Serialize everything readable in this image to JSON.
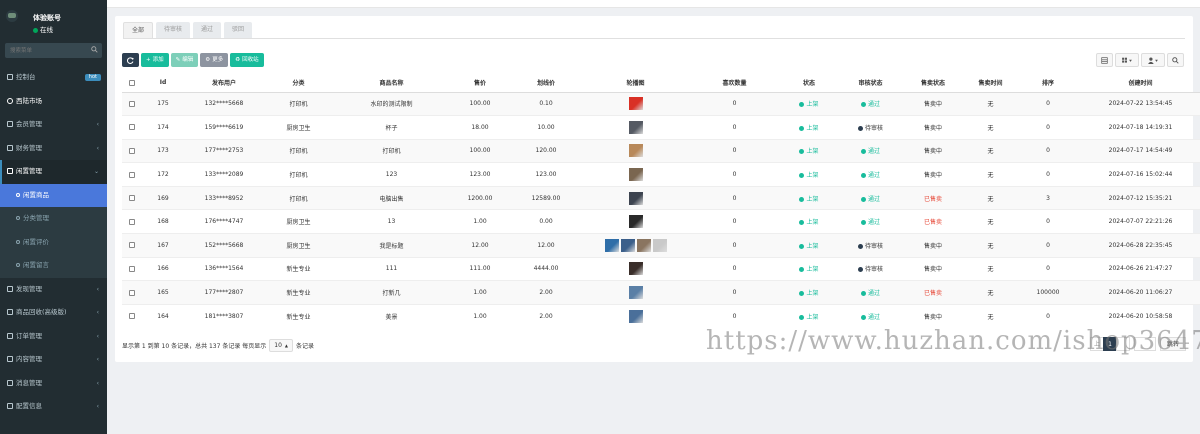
{
  "user": {
    "name": "体验账号",
    "status": "在线"
  },
  "search": {
    "placeholder": "搜索菜单"
  },
  "menu": [
    {
      "label": "控制台",
      "badge": "hot",
      "type": "top"
    },
    {
      "label": "西陆市场",
      "type": "header"
    },
    {
      "label": "会员管理",
      "type": "top"
    },
    {
      "label": "财务管理",
      "type": "top"
    },
    {
      "label": "闲置管理",
      "type": "active-parent"
    },
    {
      "label": "闲置商品",
      "type": "sub-active"
    },
    {
      "label": "分类管理",
      "type": "sub"
    },
    {
      "label": "闲置评价",
      "type": "sub"
    },
    {
      "label": "闲置留言",
      "type": "sub"
    },
    {
      "label": "发现管理",
      "type": "top"
    },
    {
      "label": "商品回收(高级版)",
      "type": "top"
    },
    {
      "label": "订单管理",
      "type": "top"
    },
    {
      "label": "内容管理",
      "type": "top"
    },
    {
      "label": "消息管理",
      "type": "top"
    },
    {
      "label": "配置信息",
      "type": "top"
    }
  ],
  "tabs": [
    "全部",
    "待审核",
    "通过",
    "驳回"
  ],
  "toolbar": {
    "add": "添加",
    "edit": "编辑",
    "more": "更多",
    "recycle": "回收站"
  },
  "columns": [
    "",
    "Id",
    "发布用户",
    "分类",
    "商品名称",
    "售价",
    "划线价",
    "轮播图",
    "喜欢数量",
    "状态",
    "审核状态",
    "售卖状态",
    "售卖时间",
    "排序",
    "创建时间",
    "操作"
  ],
  "rows": [
    {
      "id": "175",
      "user": "132****5668",
      "category": "打印机",
      "name": "水印的测试限制",
      "price": "100.00",
      "orig": "0.10",
      "thumbs": [
        "#d93025"
      ],
      "likes": "0",
      "status": "上架",
      "audit": "通过",
      "audit_color": "#18bc9c",
      "sale": "售卖中",
      "sale_red": false,
      "sale_time": "无",
      "sort": "0",
      "created": "2024-07-22 13:54:45"
    },
    {
      "id": "174",
      "user": "159****6619",
      "category": "厨房卫生",
      "name": "杯子",
      "price": "18.00",
      "orig": "10.00",
      "thumbs": [
        "#555a63"
      ],
      "likes": "0",
      "status": "上架",
      "audit": "待审核",
      "audit_color": "#2c3e50",
      "sale": "售卖中",
      "sale_red": false,
      "sale_time": "无",
      "sort": "0",
      "created": "2024-07-18 14:19:31"
    },
    {
      "id": "173",
      "user": "177****2753",
      "category": "打印机",
      "name": "打印机",
      "price": "100.00",
      "orig": "120.00",
      "thumbs": [
        "#b8895a"
      ],
      "likes": "0",
      "status": "上架",
      "audit": "通过",
      "audit_color": "#18bc9c",
      "sale": "售卖中",
      "sale_red": false,
      "sale_time": "无",
      "sort": "0",
      "created": "2024-07-17 14:54:49"
    },
    {
      "id": "172",
      "user": "133****2089",
      "category": "打印机",
      "name": "123",
      "price": "123.00",
      "orig": "123.00",
      "thumbs": [
        "#7a6650"
      ],
      "likes": "0",
      "status": "上架",
      "audit": "通过",
      "audit_color": "#18bc9c",
      "sale": "售卖中",
      "sale_red": false,
      "sale_time": "无",
      "sort": "0",
      "created": "2024-07-16 15:02:44"
    },
    {
      "id": "169",
      "user": "133****8952",
      "category": "打印机",
      "name": "电脑出售",
      "price": "1200.00",
      "orig": "12589.00",
      "thumbs": [
        "#3d4450"
      ],
      "likes": "0",
      "status": "上架",
      "audit": "通过",
      "audit_color": "#18bc9c",
      "sale": "已售卖",
      "sale_red": true,
      "sale_time": "无",
      "sort": "3",
      "created": "2024-07-12 15:35:21"
    },
    {
      "id": "168",
      "user": "176****4747",
      "category": "厨房卫生",
      "name": "13",
      "price": "1.00",
      "orig": "0.00",
      "thumbs": [
        "#2a2a2a"
      ],
      "likes": "0",
      "status": "上架",
      "audit": "通过",
      "audit_color": "#18bc9c",
      "sale": "已售卖",
      "sale_red": true,
      "sale_time": "无",
      "sort": "0",
      "created": "2024-07-07 22:21:26"
    },
    {
      "id": "167",
      "user": "152****5668",
      "category": "厨房卫生",
      "name": "我是标题",
      "price": "12.00",
      "orig": "12.00",
      "thumbs": [
        "#2f6ea8",
        "#3b5f8a",
        "#8a7560",
        "#c9c9c9"
      ],
      "likes": "0",
      "status": "上架",
      "audit": "待审核",
      "audit_color": "#2c3e50",
      "sale": "售卖中",
      "sale_red": false,
      "sale_time": "无",
      "sort": "0",
      "created": "2024-06-28 22:35:45"
    },
    {
      "id": "166",
      "user": "136****1564",
      "category": "新生专业",
      "name": "111",
      "price": "111.00",
      "orig": "4444.00",
      "thumbs": [
        "#3a2e2a"
      ],
      "likes": "0",
      "status": "上架",
      "audit": "待审核",
      "audit_color": "#2c3e50",
      "sale": "售卖中",
      "sale_red": false,
      "sale_time": "无",
      "sort": "0",
      "created": "2024-06-26 21:47:27"
    },
    {
      "id": "165",
      "user": "177****2807",
      "category": "新生专业",
      "name": "打新几",
      "price": "1.00",
      "orig": "2.00",
      "thumbs": [
        "#5a7fa6"
      ],
      "likes": "0",
      "status": "上架",
      "audit": "通过",
      "audit_color": "#18bc9c",
      "sale": "已售卖",
      "sale_red": true,
      "sale_time": "无",
      "sort": "100000",
      "created": "2024-06-20 11:06:27"
    },
    {
      "id": "164",
      "user": "181****3807",
      "category": "新生专业",
      "name": "美景",
      "price": "1.00",
      "orig": "2.00",
      "thumbs": [
        "#4a6f9a"
      ],
      "likes": "0",
      "status": "上架",
      "audit": "通过",
      "audit_color": "#18bc9c",
      "sale": "售卖中",
      "sale_red": false,
      "sale_time": "无",
      "sort": "0",
      "created": "2024-06-20 10:58:58"
    }
  ],
  "footer": {
    "info_before": "显示第 1 到第 10 条记录，总共 137 条记录 每页显示",
    "page_size": "10",
    "info_after": "条记录"
  },
  "pager": {
    "prev": "上",
    "current": "1",
    "jump": "跳转"
  },
  "watermark": "https://www.huzhan.com/ishop3647",
  "colors": {
    "sidebar": "#222d32",
    "accent": "#18bc9c",
    "active_menu": "#4a78db",
    "danger": "#e74c3c",
    "dark": "#2c3e50"
  }
}
